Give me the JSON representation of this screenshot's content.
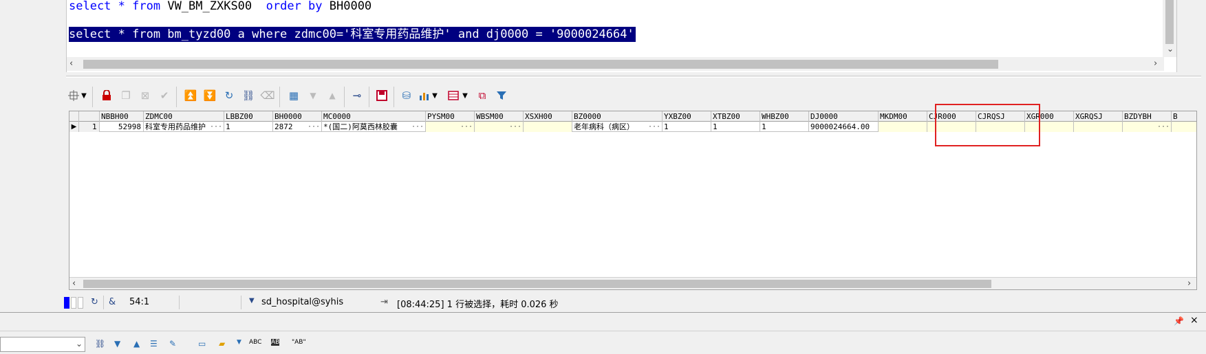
{
  "editor": {
    "line1": {
      "kw1": "select",
      "rest1": " * ",
      "kw2": "from",
      "rest2": " VW_BM_ZXKS00  ",
      "kw3": "order by",
      "rest3": " BH0000"
    },
    "line2": "select * from bm_tyzd00 a where zdmc00='科室专用药品维护' and dj0000 = '9000024664'"
  },
  "grid": {
    "columns": [
      "NBBH00",
      "ZDMC00",
      "LBBZ00",
      "BH0000",
      "MC0000",
      "PYSM00",
      "WBSM00",
      "XSXH00",
      "BZ0000",
      "YXBZ00",
      "XTBZ00",
      "WHBZ00",
      "DJ0000",
      "MKDM00",
      "CJR000",
      "CJRQSJ",
      "XGR000",
      "XGRQSJ",
      "BZDYBH",
      "B"
    ],
    "row": {
      "row_number": "1",
      "NBBH00": "52998",
      "ZDMC00": "科室专用药品维护",
      "LBBZ00": "1",
      "BH0000": "2872",
      "MC0000": "*(国二)阿莫西林胶囊",
      "BZ0000": "老年病科（病区）",
      "YXBZ00": "1",
      "XTBZ00": "1",
      "WHBZ00": "1",
      "DJ0000": "9000024664.00"
    }
  },
  "status": {
    "position": "54:1",
    "connection": "sd_hospital@syhis",
    "message": "[08:44:25]  1 行被选择，耗时 0.026 秒"
  },
  "icons": {
    "accent": "#000080",
    "highlight": "#e02020"
  }
}
